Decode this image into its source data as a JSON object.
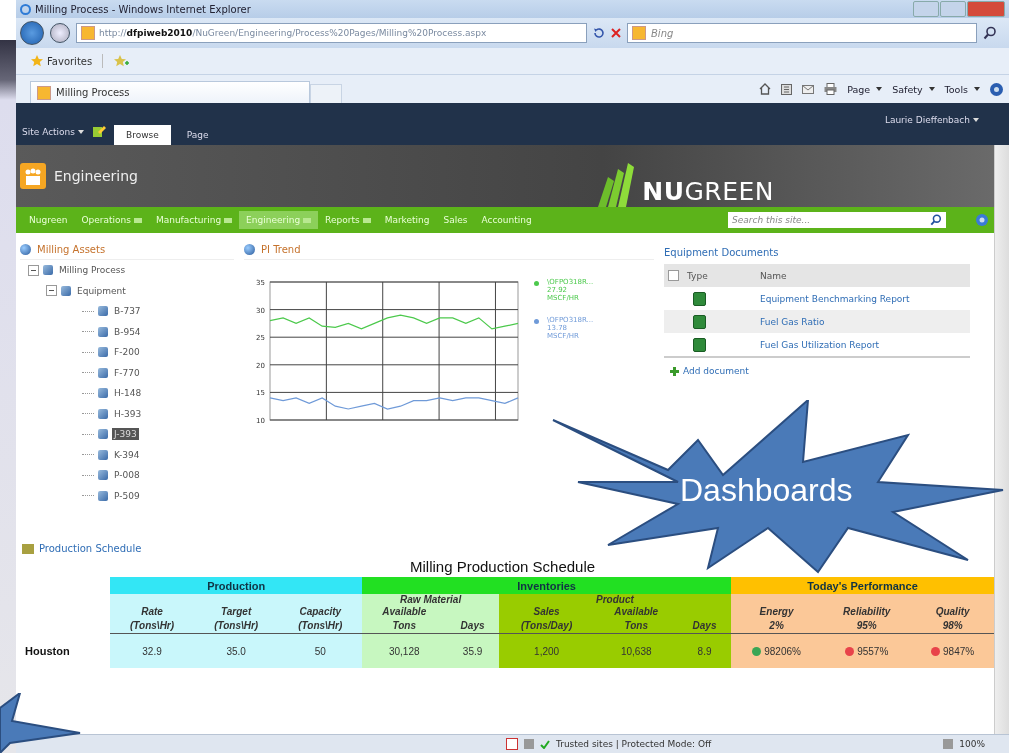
{
  "window": {
    "title": "Milling Process - Windows Internet Explorer"
  },
  "address_bar": {
    "url": "http://**dfpiweb2010**/NuGreen/Engineering/Process%20Pages/Milling%20Process.aspx",
    "search_placeholder": "Bing"
  },
  "favorites_bar": {
    "label": "Favorites"
  },
  "browser_tab": {
    "title": "Milling Process"
  },
  "command_bar": [
    "Page",
    "Safety",
    "Tools"
  ],
  "ribbon": {
    "site_actions": "Site Actions",
    "tabs": [
      {
        "label": "Browse",
        "selected": true
      },
      {
        "label": "Page",
        "selected": false
      }
    ],
    "user": "Laurie Dieffenbach"
  },
  "site_header": {
    "title": "Engineering",
    "logo_bold": "NU",
    "logo_light": "GREEN"
  },
  "top_nav": {
    "items": [
      {
        "label": "Nugreen",
        "selected": false,
        "has_menu": false
      },
      {
        "label": "Operations",
        "selected": false,
        "has_menu": true
      },
      {
        "label": "Manufacturing",
        "selected": false,
        "has_menu": true
      },
      {
        "label": "Engineering",
        "selected": true,
        "has_menu": true
      },
      {
        "label": "Reports",
        "selected": false,
        "has_menu": true
      },
      {
        "label": "Marketing",
        "selected": false,
        "has_menu": false
      },
      {
        "label": "Sales",
        "selected": false,
        "has_menu": false
      },
      {
        "label": "Accounting",
        "selected": false,
        "has_menu": false
      }
    ],
    "search_placeholder": "Search this site..."
  },
  "assets": {
    "title": "Milling Assets",
    "tree": [
      {
        "label": "Milling Process",
        "expanded": true,
        "selected": false,
        "children": [
          {
            "label": "Equipment",
            "expanded": true,
            "selected": false,
            "children": [
              {
                "label": "B-737",
                "selected": false
              },
              {
                "label": "B-954",
                "selected": false
              },
              {
                "label": "F-200",
                "selected": false
              },
              {
                "label": "F-770",
                "selected": false
              },
              {
                "label": "H-148",
                "selected": false
              },
              {
                "label": "H-393",
                "selected": false
              },
              {
                "label": "J-393",
                "selected": true
              },
              {
                "label": "K-394",
                "selected": false
              },
              {
                "label": "P-008",
                "selected": false
              },
              {
                "label": "P-509",
                "selected": false
              }
            ]
          }
        ]
      }
    ]
  },
  "trend": {
    "title": "PI Trend",
    "legend": [
      {
        "value": "27.92",
        "unit": "MSCF/HR"
      },
      {
        "value": "13.78",
        "unit": "MSCF/HR"
      }
    ],
    "chart_data": {
      "type": "line",
      "ylim": [
        10,
        35
      ],
      "yticks": [
        10,
        15,
        20,
        25,
        30,
        35
      ],
      "grid": true,
      "series": [
        {
          "name": "\\OFPO318R...",
          "color": "#4cc94c",
          "values": [
            28,
            28.5,
            27.5,
            28.5,
            27,
            26.8,
            27.5,
            26.5,
            27.5,
            28.5,
            29,
            28.5,
            27.5,
            28.5,
            28.5,
            27.5,
            28.5,
            26.5,
            27,
            27.5
          ]
        },
        {
          "name": "\\OFPO318R...",
          "color": "#6f9ad8",
          "values": [
            14,
            13.5,
            14,
            13,
            14,
            12.5,
            12,
            12.5,
            13,
            12,
            12.5,
            13.5,
            13.5,
            14,
            13.5,
            14,
            14,
            13.5,
            13,
            14
          ]
        }
      ]
    }
  },
  "documents": {
    "title": "Equipment Documents",
    "select_all_checked": false,
    "columns": [
      "Type",
      "Name"
    ],
    "rows": [
      {
        "name": "Equipment Benchmarking Report"
      },
      {
        "name": "Fuel Gas Ratio"
      },
      {
        "name": "Fuel Gas Utilization Report"
      }
    ],
    "add_link": "Add document"
  },
  "schedule": {
    "link": "Production Schedule",
    "title": "Milling Production Schedule",
    "groups": [
      {
        "label": "Production",
        "color": "#33e6f5",
        "subgroups": [
          {
            "color": "#c9f7fb",
            "columns": [
              {
                "lines": [
                  "Rate",
                  "(Tons\\Hr)"
                ]
              },
              {
                "lines": [
                  "Target",
                  "(Tons\\Hr)"
                ]
              },
              {
                "lines": [
                  "Capacity",
                  "(Tons\\Hr)"
                ]
              }
            ]
          }
        ]
      },
      {
        "label": "Inventories",
        "color": "#22e022",
        "subgroups": [
          {
            "label": "Raw Material",
            "color": "#c7f7c0",
            "columns": [
              {
                "lines": [
                  "Available",
                  "Tons"
                ]
              },
              {
                "lines": [
                  "Days"
                ]
              }
            ]
          },
          {
            "label": "Product",
            "color": "#99cc00",
            "columns": [
              {
                "lines": [
                  "Sales",
                  "(Tons/Day)"
                ]
              },
              {
                "lines": [
                  "Available",
                  "Tons"
                ]
              },
              {
                "lines": [
                  "Days"
                ]
              }
            ]
          }
        ]
      },
      {
        "label": "Today's Performance",
        "color": "#ffc000",
        "subgroups": [
          {
            "color": "#fbc898",
            "columns": [
              {
                "lines": [
                  "Energy",
                  "2%"
                ]
              },
              {
                "lines": [
                  "Reliability",
                  "95%"
                ]
              },
              {
                "lines": [
                  "Quality",
                  "98%"
                ]
              }
            ]
          }
        ]
      }
    ],
    "rows": [
      {
        "site": "Houston",
        "cells": [
          "32.9",
          "35.0",
          "50",
          "30,128",
          "35.9",
          "1,200",
          "10,638",
          "8.9"
        ],
        "performance": [
          {
            "value": "98206%",
            "color": "#3aa655"
          },
          {
            "value": "9557%",
            "color": "#e8434a"
          },
          {
            "value": "9847%",
            "color": "#e8434a"
          }
        ]
      }
    ]
  },
  "callout": {
    "text": "Dashboards"
  },
  "status_bar": {
    "zone": "Trusted sites | Protected Mode: Off",
    "zoom": "100%"
  }
}
